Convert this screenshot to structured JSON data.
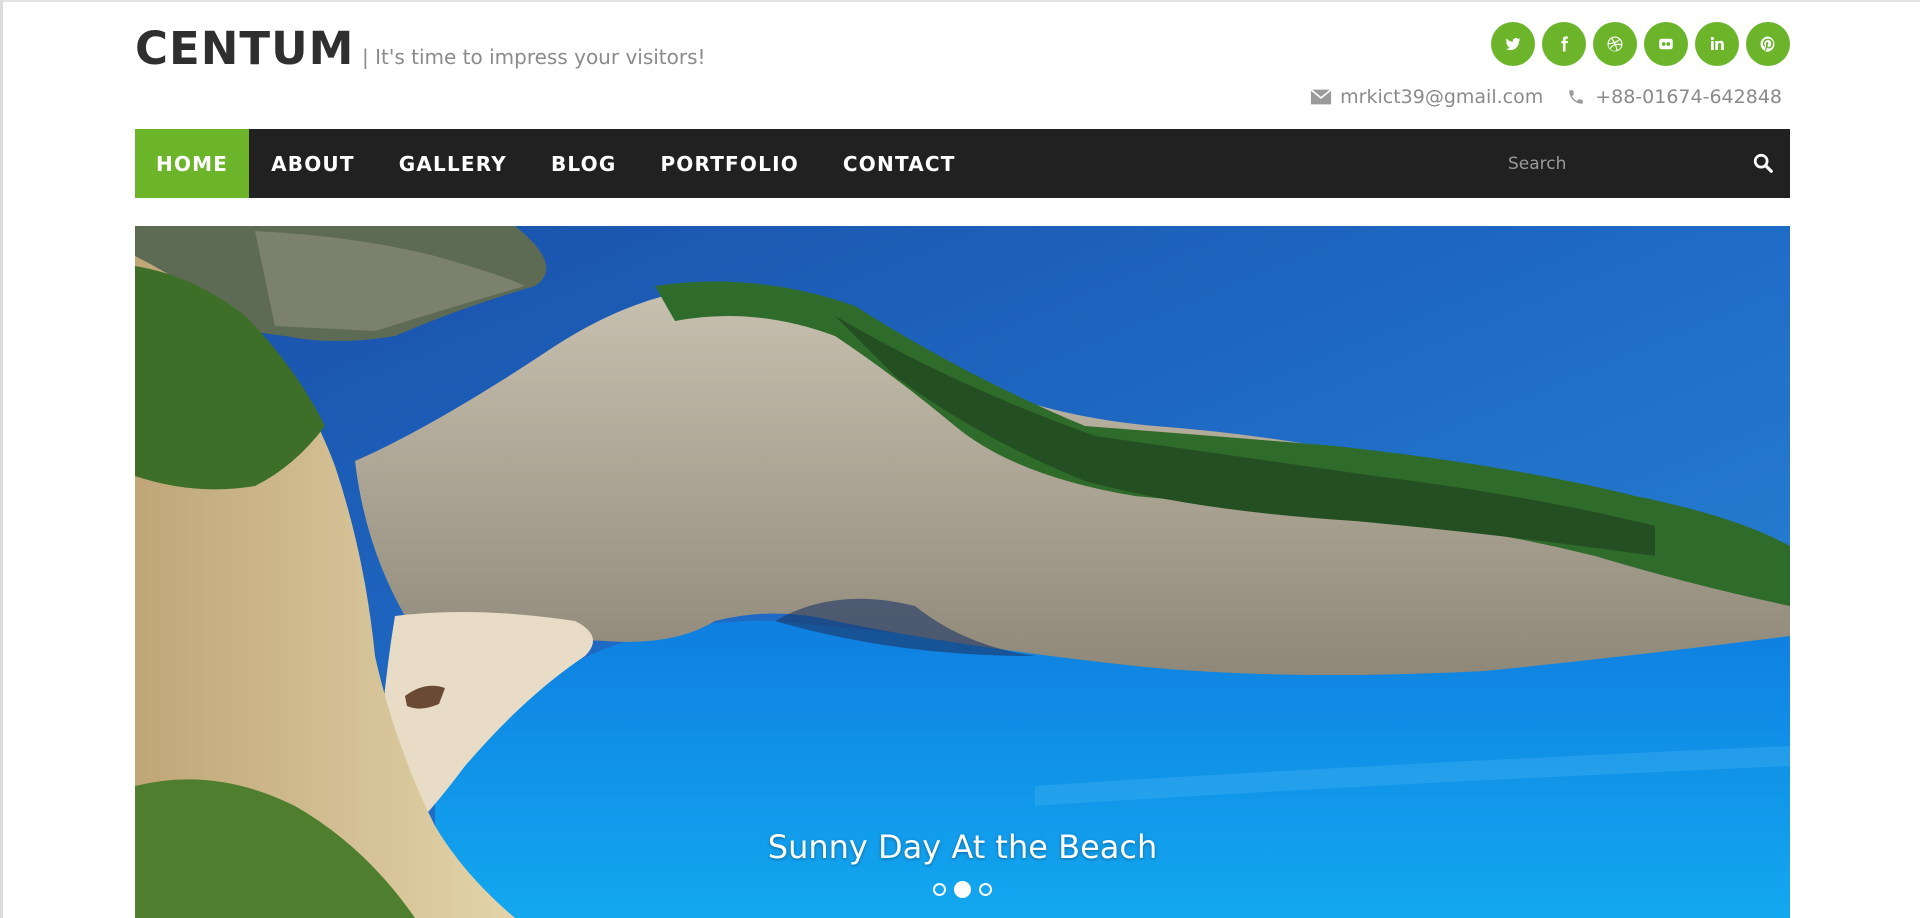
{
  "site": {
    "logo": "CENTUM",
    "tagline": "| It's time to impress your visitors!"
  },
  "social": [
    {
      "icon": "twitter-icon"
    },
    {
      "icon": "facebook-icon"
    },
    {
      "icon": "dribbble-icon"
    },
    {
      "icon": "flickr-icon"
    },
    {
      "icon": "linkedin-icon"
    },
    {
      "icon": "pinterest-icon"
    }
  ],
  "contact": {
    "email": "mrkict39@gmail.com",
    "phone": "+88-01674-642848"
  },
  "nav": {
    "items": [
      {
        "label": "HOME"
      },
      {
        "label": "ABOUT"
      },
      {
        "label": "GALLERY"
      },
      {
        "label": "BLOG"
      },
      {
        "label": "PORTFOLIO"
      },
      {
        "label": "CONTACT"
      }
    ],
    "search_placeholder": "Search"
  },
  "slider": {
    "caption": "Sunny Day At the Beach",
    "slide_count": 3,
    "active_slide": 2
  },
  "colors": {
    "accent": "#6cb52b",
    "nav_bg": "#212121"
  }
}
